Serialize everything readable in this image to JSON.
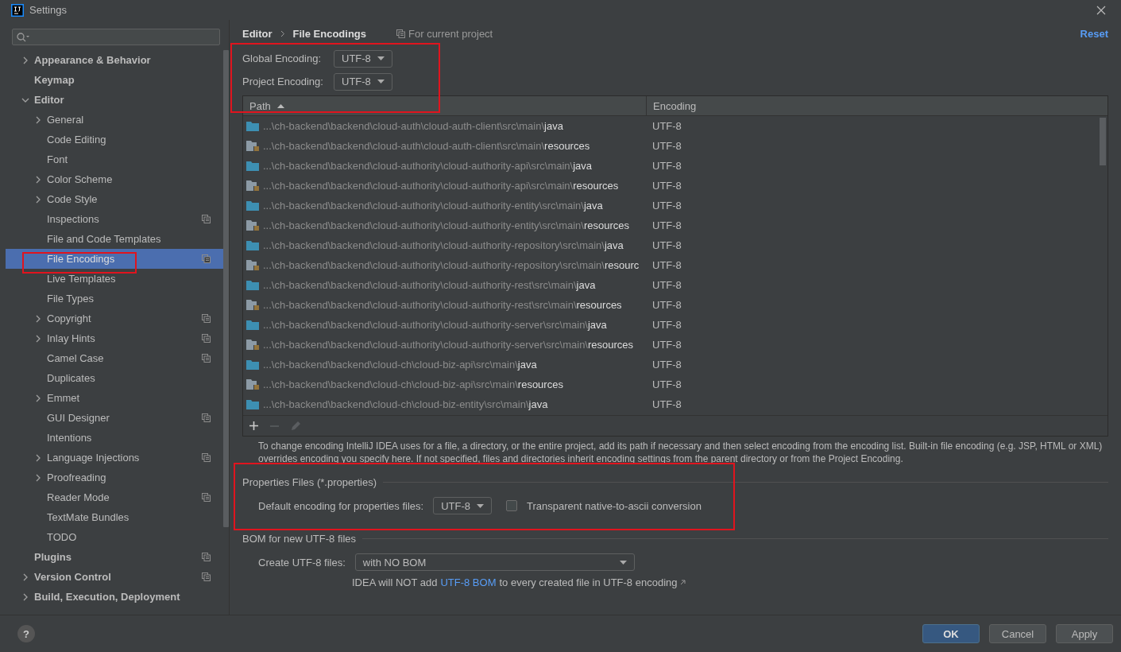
{
  "window": {
    "title": "Settings"
  },
  "sidebar": {
    "items": [
      {
        "label": "Appearance & Behavior",
        "expandable": true,
        "expanded": false,
        "selected": false,
        "project_scope": false
      },
      {
        "label": "Keymap",
        "expandable": false,
        "selected": false,
        "project_scope": false
      },
      {
        "label": "Editor",
        "expandable": true,
        "expanded": true,
        "selected": false,
        "project_scope": false,
        "children": [
          {
            "label": "General",
            "expandable": true,
            "expanded": false,
            "selected": false,
            "project_scope": false
          },
          {
            "label": "Code Editing",
            "expandable": false,
            "selected": false,
            "project_scope": false
          },
          {
            "label": "Font",
            "expandable": false,
            "selected": false,
            "project_scope": false
          },
          {
            "label": "Color Scheme",
            "expandable": true,
            "expanded": false,
            "selected": false,
            "project_scope": false
          },
          {
            "label": "Code Style",
            "expandable": true,
            "expanded": false,
            "selected": false,
            "project_scope": false
          },
          {
            "label": "Inspections",
            "expandable": false,
            "selected": false,
            "project_scope": true
          },
          {
            "label": "File and Code Templates",
            "expandable": false,
            "selected": false,
            "project_scope": false
          },
          {
            "label": "File Encodings",
            "expandable": false,
            "selected": true,
            "project_scope": true
          },
          {
            "label": "Live Templates",
            "expandable": false,
            "selected": false,
            "project_scope": false
          },
          {
            "label": "File Types",
            "expandable": false,
            "selected": false,
            "project_scope": false
          },
          {
            "label": "Copyright",
            "expandable": true,
            "expanded": false,
            "selected": false,
            "project_scope": true
          },
          {
            "label": "Inlay Hints",
            "expandable": true,
            "expanded": false,
            "selected": false,
            "project_scope": true
          },
          {
            "label": "Camel Case",
            "expandable": false,
            "selected": false,
            "project_scope": true
          },
          {
            "label": "Duplicates",
            "expandable": false,
            "selected": false,
            "project_scope": false
          },
          {
            "label": "Emmet",
            "expandable": true,
            "expanded": false,
            "selected": false,
            "project_scope": false
          },
          {
            "label": "GUI Designer",
            "expandable": false,
            "selected": false,
            "project_scope": true
          },
          {
            "label": "Intentions",
            "expandable": false,
            "selected": false,
            "project_scope": false
          },
          {
            "label": "Language Injections",
            "expandable": true,
            "expanded": false,
            "selected": false,
            "project_scope": true
          },
          {
            "label": "Proofreading",
            "expandable": true,
            "expanded": false,
            "selected": false,
            "project_scope": false
          },
          {
            "label": "Reader Mode",
            "expandable": false,
            "selected": false,
            "project_scope": true
          },
          {
            "label": "TextMate Bundles",
            "expandable": false,
            "selected": false,
            "project_scope": false
          },
          {
            "label": "TODO",
            "expandable": false,
            "selected": false,
            "project_scope": false
          }
        ]
      },
      {
        "label": "Plugins",
        "expandable": false,
        "selected": false,
        "project_scope": true
      },
      {
        "label": "Version Control",
        "expandable": true,
        "expanded": false,
        "selected": false,
        "project_scope": true
      },
      {
        "label": "Build, Execution, Deployment",
        "expandable": true,
        "expanded": false,
        "selected": false,
        "project_scope": false
      }
    ]
  },
  "breadcrumb": [
    "Editor",
    "File Encodings"
  ],
  "scope_note": "For current project",
  "reset": "Reset",
  "encodings": [
    {
      "label": "Global Encoding:",
      "value": "UTF-8"
    },
    {
      "label": "Project Encoding:",
      "value": "UTF-8"
    }
  ],
  "table": {
    "columns": [
      {
        "label": "Path",
        "sorted": true
      },
      {
        "label": "Encoding",
        "sorted": false
      }
    ],
    "rows": [
      {
        "kind": "source",
        "prefix": "...\\ch-backend\\backend\\cloud-auth\\cloud-auth-client\\src\\main\\",
        "leaf": "java",
        "encoding": "UTF-8"
      },
      {
        "kind": "resources",
        "prefix": "...\\ch-backend\\backend\\cloud-auth\\cloud-auth-client\\src\\main\\",
        "leaf": "resources",
        "encoding": "UTF-8"
      },
      {
        "kind": "source",
        "prefix": "...\\ch-backend\\backend\\cloud-authority\\cloud-authority-api\\src\\main\\",
        "leaf": "java",
        "encoding": "UTF-8"
      },
      {
        "kind": "resources",
        "prefix": "...\\ch-backend\\backend\\cloud-authority\\cloud-authority-api\\src\\main\\",
        "leaf": "resources",
        "encoding": "UTF-8"
      },
      {
        "kind": "source",
        "prefix": "...\\ch-backend\\backend\\cloud-authority\\cloud-authority-entity\\src\\main\\",
        "leaf": "java",
        "encoding": "UTF-8"
      },
      {
        "kind": "resources",
        "prefix": "...\\ch-backend\\backend\\cloud-authority\\cloud-authority-entity\\src\\main\\",
        "leaf": "resources",
        "encoding": "UTF-8"
      },
      {
        "kind": "source",
        "prefix": "...\\ch-backend\\backend\\cloud-authority\\cloud-authority-repository\\src\\main\\",
        "leaf": "java",
        "encoding": "UTF-8"
      },
      {
        "kind": "resources",
        "prefix": "...\\ch-backend\\backend\\cloud-authority\\cloud-authority-repository\\src\\main\\",
        "leaf": "resourc",
        "encoding": "UTF-8"
      },
      {
        "kind": "source",
        "prefix": "...\\ch-backend\\backend\\cloud-authority\\cloud-authority-rest\\src\\main\\",
        "leaf": "java",
        "encoding": "UTF-8"
      },
      {
        "kind": "resources",
        "prefix": "...\\ch-backend\\backend\\cloud-authority\\cloud-authority-rest\\src\\main\\",
        "leaf": "resources",
        "encoding": "UTF-8"
      },
      {
        "kind": "source",
        "prefix": "...\\ch-backend\\backend\\cloud-authority\\cloud-authority-server\\src\\main\\",
        "leaf": "java",
        "encoding": "UTF-8"
      },
      {
        "kind": "resources",
        "prefix": "...\\ch-backend\\backend\\cloud-authority\\cloud-authority-server\\src\\main\\",
        "leaf": "resources",
        "encoding": "UTF-8"
      },
      {
        "kind": "source",
        "prefix": "...\\ch-backend\\backend\\cloud-ch\\cloud-biz-api\\src\\main\\",
        "leaf": "java",
        "encoding": "UTF-8"
      },
      {
        "kind": "resources",
        "prefix": "...\\ch-backend\\backend\\cloud-ch\\cloud-biz-api\\src\\main\\",
        "leaf": "resources",
        "encoding": "UTF-8"
      },
      {
        "kind": "source",
        "prefix": "...\\ch-backend\\backend\\cloud-ch\\cloud-biz-entity\\src\\main\\",
        "leaf": "java",
        "encoding": "UTF-8"
      }
    ]
  },
  "hint": "To change encoding IntelliJ IDEA uses for a file, a directory, or the entire project, add its path if necessary and then select encoding from the encoding list. Built-in file encoding (e.g. JSP, HTML or XML) overrides encoding you specify here. If not specified, files and directories inherit encoding settings from the parent directory or from the Project Encoding.",
  "properties": {
    "title": "Properties Files (*.properties)",
    "label": "Default encoding for properties files:",
    "value": "UTF-8",
    "checkbox": {
      "label": "Transparent native-to-ascii conversion",
      "checked": false
    }
  },
  "bom": {
    "title": "BOM for new UTF-8 files",
    "label": "Create UTF-8 files:",
    "value": "with NO BOM",
    "note_before": "IDEA will NOT add",
    "link": "UTF-8 BOM",
    "note_after": "to every created file in UTF-8 encoding"
  },
  "help_button": "?",
  "buttons": [
    {
      "label": "OK",
      "kind": "primary",
      "disabled": false
    },
    {
      "label": "Cancel",
      "kind": "normal",
      "disabled": false
    },
    {
      "label": "Apply",
      "kind": "normal",
      "disabled": false
    }
  ]
}
